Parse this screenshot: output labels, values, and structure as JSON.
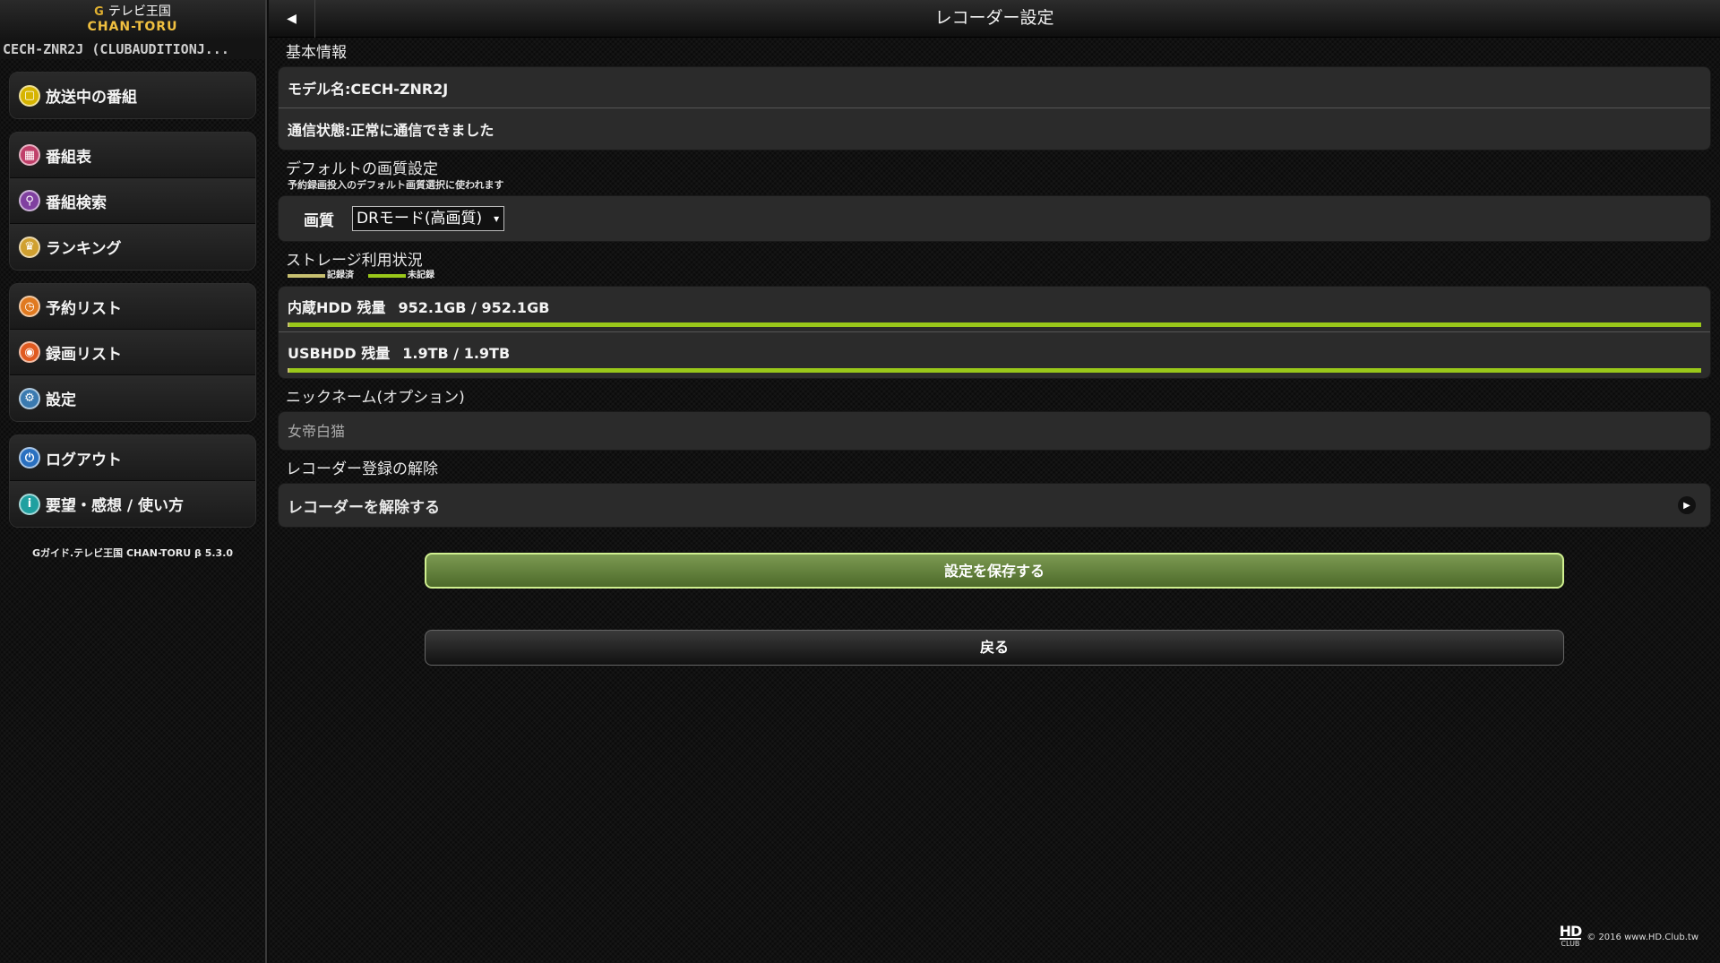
{
  "brand": {
    "g_logo": "G",
    "tv_label": "テレビ王国",
    "name": "CHAN-TORU"
  },
  "device_name": "CECH-ZNR2J (CLUBAUDITIONJ...",
  "sidebar": {
    "groups": [
      [
        {
          "label": "放送中の番組",
          "icon": "tv-icon",
          "color": "#d6b400"
        }
      ],
      [
        {
          "label": "番組表",
          "icon": "grid-icon",
          "color": "#c0406a"
        },
        {
          "label": "番組検索",
          "icon": "search-icon",
          "color": "#8040a0"
        },
        {
          "label": "ランキング",
          "icon": "crown-icon",
          "color": "#d0a030"
        }
      ],
      [
        {
          "label": "予約リスト",
          "icon": "clock-icon",
          "color": "#e07a20"
        },
        {
          "label": "録画リスト",
          "icon": "record-icon",
          "color": "#e05a20"
        },
        {
          "label": "設定",
          "icon": "gear-icon",
          "color": "#3a7ab0"
        }
      ],
      [
        {
          "label": "ログアウト",
          "icon": "logout-icon",
          "color": "#2a70c0"
        },
        {
          "label": "要望・感想 / 使い方",
          "icon": "info-icon",
          "color": "#20a0a0"
        }
      ]
    ],
    "version": "Gガイド.テレビ王国 CHAN-TORU β 5.3.0"
  },
  "header": {
    "back_glyph": "◀",
    "title": "レコーダー設定"
  },
  "basic_info": {
    "title": "基本情報",
    "model": "モデル名:CECH-ZNR2J",
    "status": "通信状態:正常に通信できました"
  },
  "quality": {
    "title": "デフォルトの画質設定",
    "subtitle": "予約録画投入のデフォルト画質選択に使われます",
    "label": "画質",
    "selected": "DRモード(高画質)"
  },
  "storage": {
    "title": "ストレージ利用状況",
    "legend_recorded": "記録済",
    "legend_unrecorded": "未記録",
    "colors": {
      "recorded": "#c8c070",
      "unrecorded": "#9ac81a"
    },
    "internal": {
      "label": "内蔵HDD 残量",
      "value": "952.1GB / 952.1GB",
      "used_fraction": 0.001
    },
    "usb": {
      "label": "USBHDD 残量",
      "value": "1.9TB / 1.9TB",
      "used_fraction": 0.001
    }
  },
  "nickname": {
    "title": "ニックネーム(オプション)",
    "value": "女帝白猫"
  },
  "release": {
    "title": "レコーダー登録の解除",
    "action": "レコーダーを解除する",
    "chevron": "▶"
  },
  "buttons": {
    "save": "設定を保存する",
    "back": "戻る"
  },
  "footer": {
    "hd_logo": "HD",
    "club": "CLUB",
    "copyright": "© 2016 www.HD.Club.tw"
  }
}
